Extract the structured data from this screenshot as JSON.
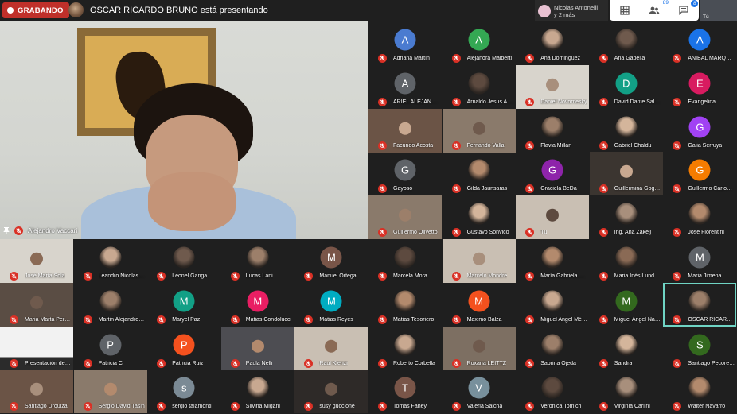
{
  "header": {
    "recording_label": "GRABANDO",
    "presenting_text": "OSCAR RICARDO BRUNO está presentando",
    "notification": {
      "line1": "Nicolas Antonelli",
      "line2": "y 2 más"
    },
    "toolbar": {
      "grid_icon": "grid-icon",
      "participants_icon": "people-icon",
      "participants_count": "89",
      "chat_icon": "chat-icon",
      "chat_badge": "8"
    },
    "self_label": "Tú"
  },
  "main_video": {
    "name": "Alejandro Vaccari"
  },
  "colors": {
    "recording": "#c0302a",
    "mic_muted": "#d93025",
    "highlight": "#6fd4c4",
    "tile_bg": "#1f1f1f"
  },
  "participants": [
    {
      "name": "Adriana Martín",
      "initial": "A",
      "color": "#4a7bd0"
    },
    {
      "name": "Alejandra Malberti",
      "initial": "A",
      "color": "#34a853"
    },
    {
      "name": "Ana Dominguez"
    },
    {
      "name": "Ana Gabella"
    },
    {
      "name": "ANIBAL MARQUEZ",
      "initial": "A",
      "color": "#1a73e8"
    },
    {
      "name": "ARIEL ALEJANDR...",
      "initial": "A",
      "color": "#5f6368"
    },
    {
      "name": "Arnaldo Jesus Ardi..."
    },
    {
      "name": "Daniel Novomesky"
    },
    {
      "name": "David Dante Salvat...",
      "initial": "D",
      "color": "#12a086"
    },
    {
      "name": "Evangelina",
      "initial": "E",
      "color": "#d81b60"
    },
    {
      "name": "Facundo Acosta"
    },
    {
      "name": "Fernando Valla"
    },
    {
      "name": "Flavia Millan"
    },
    {
      "name": "Gabriel Chaldu"
    },
    {
      "name": "Galia Serruya",
      "initial": "G",
      "color": "#a142f4"
    },
    {
      "name": "Gayoso",
      "initial": "G",
      "color": "#5f6368"
    },
    {
      "name": "Gilda Jaunsaras"
    },
    {
      "name": "Graciela BeDa",
      "initial": "G",
      "color": "#8e24aa"
    },
    {
      "name": "Guillermina Gogniat"
    },
    {
      "name": "Guillermo Carlos N...",
      "initial": "G",
      "color": "#f57c00"
    },
    {
      "name": "Guillermo Olivetto"
    },
    {
      "name": "Gustavo Sonvico"
    },
    {
      "name": "Tú"
    },
    {
      "name": "Ing. Ana Zakelj"
    },
    {
      "name": "Jose Fiorentini"
    },
    {
      "name": "José María Sola"
    },
    {
      "name": "Leandro Nicolas Gi..."
    },
    {
      "name": "Leonel Ganga"
    },
    {
      "name": "Lucas Lani"
    },
    {
      "name": "Manuel Ortega",
      "initial": "M",
      "color": "#795548"
    },
    {
      "name": "Marcela Mora"
    },
    {
      "name": "Marcelo Mondre"
    },
    {
      "name": "María Gabriela Le..."
    },
    {
      "name": "Maria Inés Lund"
    },
    {
      "name": "Maria Jimena",
      "initial": "M",
      "color": "#5f6368"
    },
    {
      "name": "Maria Marta Persico"
    },
    {
      "name": "Martin Alejandro D..."
    },
    {
      "name": "Maryel Paz",
      "initial": "M",
      "color": "#12a086"
    },
    {
      "name": "Matias Condolucci",
      "initial": "M",
      "color": "#e91e63"
    },
    {
      "name": "Matias Reyes",
      "initial": "M",
      "color": "#00acc1"
    },
    {
      "name": "Matias Tesoriero"
    },
    {
      "name": "Maximo Balza",
      "initial": "M",
      "color": "#f4511e"
    },
    {
      "name": "Miguel Angel Mén..."
    },
    {
      "name": "Miguel Angel Nasso",
      "initial": "M",
      "color": "#33691e"
    },
    {
      "name": "OSCAR RICARDO ..."
    },
    {
      "name": "Presentación de OSCAR RICA..."
    },
    {
      "name": "Patricia C",
      "initial": "P",
      "color": "#5f6368"
    },
    {
      "name": "Patricia Ruiz",
      "initial": "P",
      "color": "#f4511e"
    },
    {
      "name": "Paula Nelli"
    },
    {
      "name": "Raul Klenzi"
    },
    {
      "name": "Roberto Corbella"
    },
    {
      "name": "Roxana LEITTZ"
    },
    {
      "name": "Sabrina Ojeda"
    },
    {
      "name": "Sandra"
    },
    {
      "name": "Santiago Pecorena",
      "initial": "S",
      "color": "#33691e"
    },
    {
      "name": "Santiago Urquiza"
    },
    {
      "name": "Sergio David Tasin"
    },
    {
      "name": "sergio talamonti",
      "initial": "s",
      "color": "#7b8a95"
    },
    {
      "name": "Silvina Migani"
    },
    {
      "name": "susy guccione"
    },
    {
      "name": "Tomas Fahey",
      "initial": "T",
      "color": "#795548"
    },
    {
      "name": "Valeria Saicha",
      "initial": "V",
      "color": "#78909c"
    },
    {
      "name": "Veronica Tomich"
    },
    {
      "name": "Virginia Carlini"
    },
    {
      "name": "Walter Navarro"
    }
  ]
}
